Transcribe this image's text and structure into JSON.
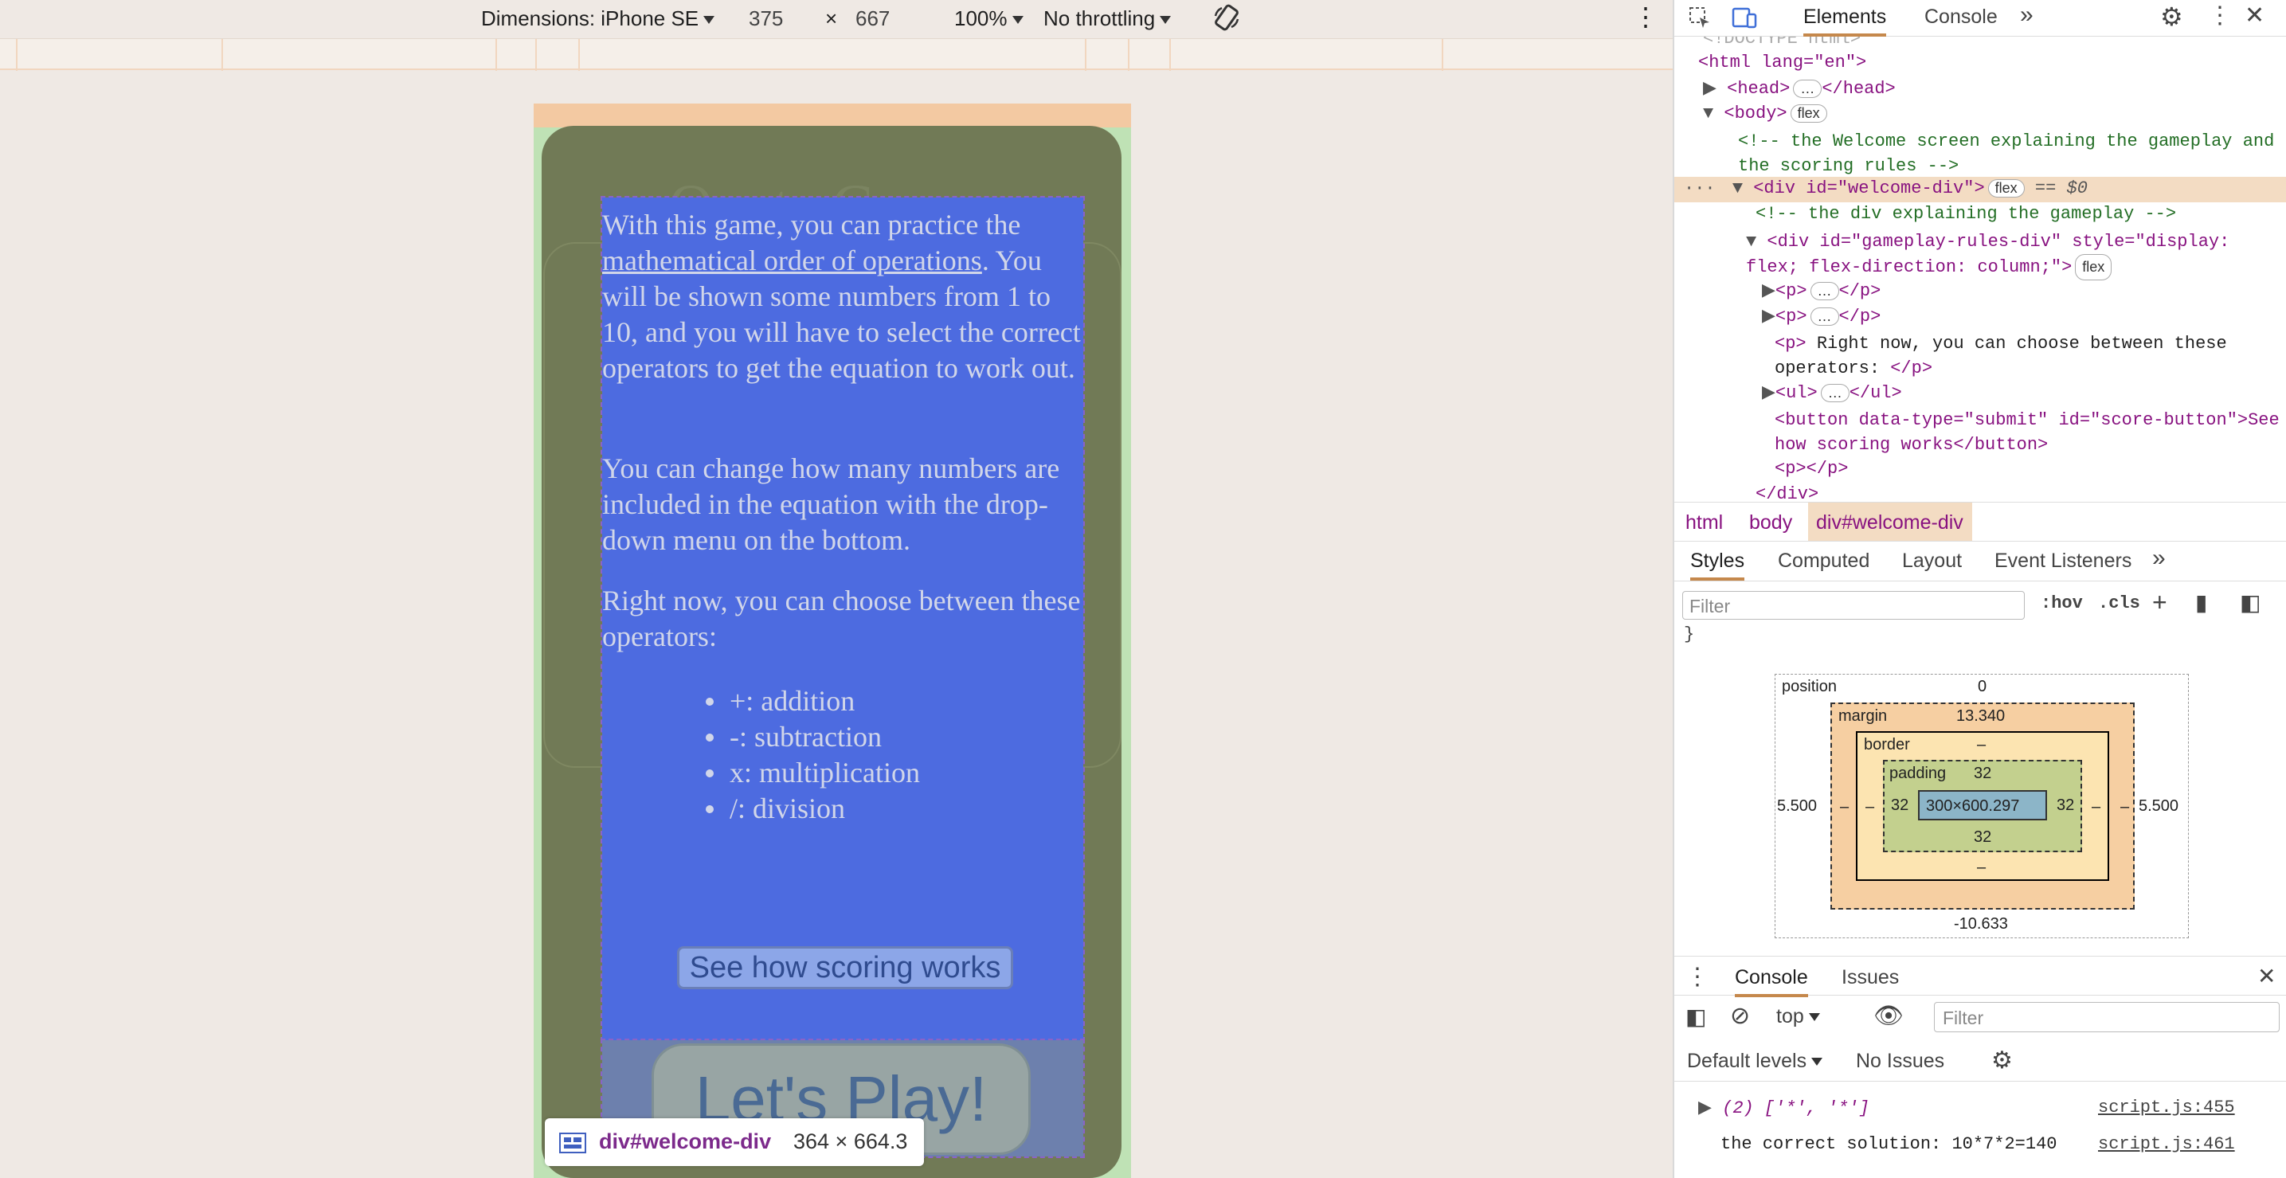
{
  "toolbar": {
    "dimensions_label": "Dimensions: iPhone SE",
    "width": "375",
    "times": "×",
    "height": "667",
    "zoom": "100%",
    "throttling": "No throttling"
  },
  "phone": {
    "ghost_title": "Quote Game",
    "rules": {
      "p1_link": "mathematical order of operations",
      "p1_before": "With this game, you can practice the",
      "p1_after": ". You will be shown some numbers from 1 to 10, and you will have to select the correct operators to get the equation to work out.",
      "p2": "You can change how many numbers are included in the equation with the drop-down menu on the bottom.",
      "p3": "Right now, you can choose between these operators:",
      "operators": [
        "+: addition",
        "-: subtraction",
        "x: multiplication",
        "/: division"
      ],
      "score_button": "See how scoring works"
    },
    "play_button": "Let's Play!",
    "tooltip": {
      "selector": "div#welcome-div",
      "size": "364 × 664.3"
    }
  },
  "devtools": {
    "tabs": [
      "Elements",
      "Console"
    ],
    "dom": {
      "doctype_cut": "<!DOCTYPE html>",
      "html_open": "<html lang=\"en\">",
      "head": "<head>",
      "head_close": "</head>",
      "body": "<body>",
      "comment1": "<!-- the Welcome screen explaining the gameplay and the scoring rules -->",
      "welcome_div": "<div id=\"welcome-div\">",
      "selected_marker": "== $0",
      "comment2": "<!-- the div explaining the gameplay -->",
      "gameplay_div": "<div id=\"gameplay-rules-div\" style=\"display: flex; flex-direction: column;\">",
      "p_collapsed": "<p>",
      "p_close": "</p>",
      "p_text": "Right now, you can choose between these operators: ",
      "ul_collapsed": "<ul>",
      "ul_close": "</ul>",
      "button_line": "<button data-type=\"submit\" id=\"score-button\">See how scoring works</button>",
      "p_empty": "<p></p>",
      "div_close": "</div>",
      "flex_badge": "flex"
    },
    "breadcrumbs": [
      "html",
      "body",
      "div#welcome-div"
    ],
    "style_tabs": [
      "Styles",
      "Computed",
      "Layout",
      "Event Listeners"
    ],
    "filter_placeholder": "Filter",
    "hov": ":hov",
    "cls": ".cls",
    "closing_brace": "}",
    "box_model": {
      "position_label": "position",
      "position_value": "0",
      "margin_label": "margin",
      "margin_top": "13.340",
      "margin_left": "5.500",
      "margin_right": "5.500",
      "margin_bottom": "-10.633",
      "border_label": "border",
      "border_value": "–",
      "padding_label": "padding",
      "padding_value": "32",
      "content": "300×600.297",
      "dash": "–"
    },
    "drawer": {
      "tabs": [
        "Console",
        "Issues"
      ],
      "context": "top",
      "filter_placeholder": "Filter",
      "levels": "Default levels",
      "issues": "No Issues",
      "logs": [
        {
          "text": "(2) ['*', '*']",
          "source": "script.js:455"
        },
        {
          "text": "the correct solution: 10*7*2=140",
          "source": "script.js:461"
        }
      ]
    }
  }
}
